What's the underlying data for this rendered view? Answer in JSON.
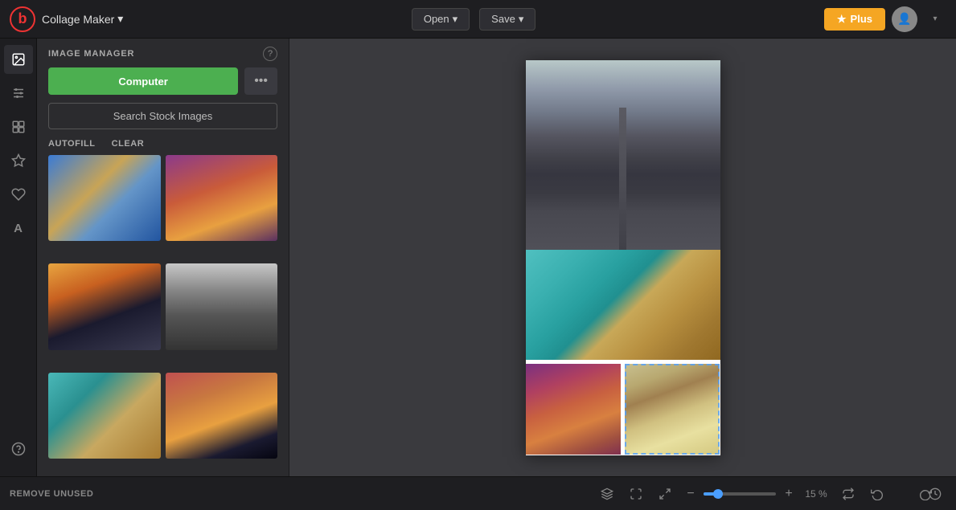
{
  "topbar": {
    "logo_text": "b",
    "app_name": "Collage Maker",
    "app_name_chevron": "▾",
    "open_label": "Open",
    "open_chevron": "▾",
    "save_label": "Save",
    "save_chevron": "▾",
    "plus_label": "Plus",
    "plus_star": "★",
    "avatar_text": "👤"
  },
  "iconbar": {
    "items": [
      {
        "name": "image-icon",
        "icon": "🖼",
        "active": true
      },
      {
        "name": "adjust-icon",
        "icon": "⚙"
      },
      {
        "name": "layout-icon",
        "icon": "▦"
      },
      {
        "name": "text-icon-bar",
        "icon": "✏"
      },
      {
        "name": "heart-icon",
        "icon": "♡"
      },
      {
        "name": "font-icon",
        "icon": "A"
      }
    ]
  },
  "panel": {
    "title": "IMAGE MANAGER",
    "help_label": "?",
    "computer_btn": "Computer",
    "more_btn": "•••",
    "stock_btn": "Search Stock Images",
    "autofill_label": "AUTOFILL",
    "clear_label": "CLEAR"
  },
  "bottom": {
    "remove_unused_label": "REMOVE UNUSED",
    "zoom_minus": "−",
    "zoom_plus": "+",
    "zoom_percent": "15 %",
    "zoom_value": 15
  }
}
